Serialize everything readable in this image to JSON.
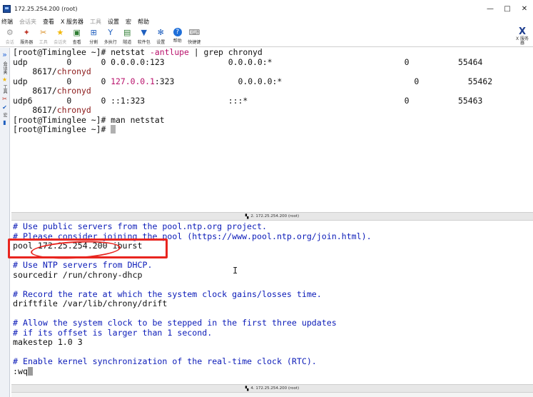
{
  "window": {
    "title": "172.25.254.200 (root)",
    "controls": [
      "—",
      "□",
      "✕"
    ]
  },
  "menu": [
    "终端",
    "会话夹",
    "查看",
    "X 服务器",
    "工具",
    "设置",
    "宏",
    "帮助"
  ],
  "toolbar": {
    "items": [
      {
        "label": "会话",
        "icon": "sessions-icon"
      },
      {
        "label": "服务器",
        "icon": "server-icon"
      },
      {
        "label": "工具",
        "icon": "tools-icon"
      },
      {
        "label": "会话夹",
        "icon": "favorites-icon"
      },
      {
        "label": "查看",
        "icon": "view-icon"
      },
      {
        "label": "分割",
        "icon": "split-icon"
      },
      {
        "label": "多执行",
        "icon": "multi-exec-icon"
      },
      {
        "label": "隧道",
        "icon": "tunnel-icon"
      },
      {
        "label": "软件包",
        "icon": "packages-icon"
      },
      {
        "label": "设置",
        "icon": "settings-icon"
      },
      {
        "label": "帮助",
        "icon": "help-icon"
      },
      {
        "label": "快捷键",
        "icon": "shortcut-icon"
      }
    ],
    "xserver_label": "X 服务器"
  },
  "sidebar": {
    "labels": [
      "会话夹",
      "工具",
      "宏"
    ]
  },
  "terminal1": {
    "prompt": "[root@Timinglee ~]# ",
    "cmd_part1": "netstat ",
    "cmd_option": "-antlupe",
    "cmd_part2": " | grep chronyd",
    "row1": "udp        0      0 0.0.0.0:123             0.0.0.0:*                           0          55464",
    "row1_cont_pid": "    8617/",
    "row1_cont_prog": "chronyd",
    "row2_pre": "udp        0      0 ",
    "row2_ip": "127.0.0.1",
    "row2_post": ":323             0.0.0.0:*                           0          55462",
    "row2_cont_pid": "    8617/",
    "row2_cont_prog": "chronyd",
    "row3": "udp6       0      0 ::1:323                 :::*                                0          55463",
    "row3_cont_pid": "    8617/",
    "row3_cont_prog": "chronyd",
    "cmd2": "[root@Timinglee ~]# man netstat",
    "prompt_last": "[root@Timinglee ~]# "
  },
  "tab_bar1": "2. 172.25.254.200 (root)",
  "terminal2": {
    "lines": [
      {
        "text": "# Use public servers from the pool.ntp.org project.",
        "type": "comment"
      },
      {
        "text": "# Please consider joining the pool (https://www.pool.ntp.org/join.html).",
        "type": "comment"
      },
      {
        "text": "pool 172.25.254.200 iburst",
        "type": "plain"
      },
      {
        "text": "",
        "type": "plain"
      },
      {
        "text": "# Use NTP servers from DHCP.",
        "type": "comment"
      },
      {
        "text": "sourcedir /run/chrony-dhcp",
        "type": "plain"
      },
      {
        "text": "",
        "type": "plain"
      },
      {
        "text": "# Record the rate at which the system clock gains/losses time.",
        "type": "comment"
      },
      {
        "text": "driftfile /var/lib/chrony/drift",
        "type": "plain"
      },
      {
        "text": "",
        "type": "plain"
      },
      {
        "text": "# Allow the system clock to be stepped in the first three updates",
        "type": "comment"
      },
      {
        "text": "# if its offset is larger than 1 second.",
        "type": "comment"
      },
      {
        "text": "makestep 1.0 3",
        "type": "plain"
      },
      {
        "text": "",
        "type": "plain"
      },
      {
        "text": "# Enable kernel synchronization of the real-time clock (RTC).",
        "type": "comment"
      }
    ],
    "command_line": ":wq"
  },
  "tab_bar2": "4. 172.25.254.200 (root)",
  "colors": {
    "annotation": "#e8251f",
    "comment": "#0b1bb8",
    "option": "#b8106b",
    "program": "#8a1616"
  }
}
